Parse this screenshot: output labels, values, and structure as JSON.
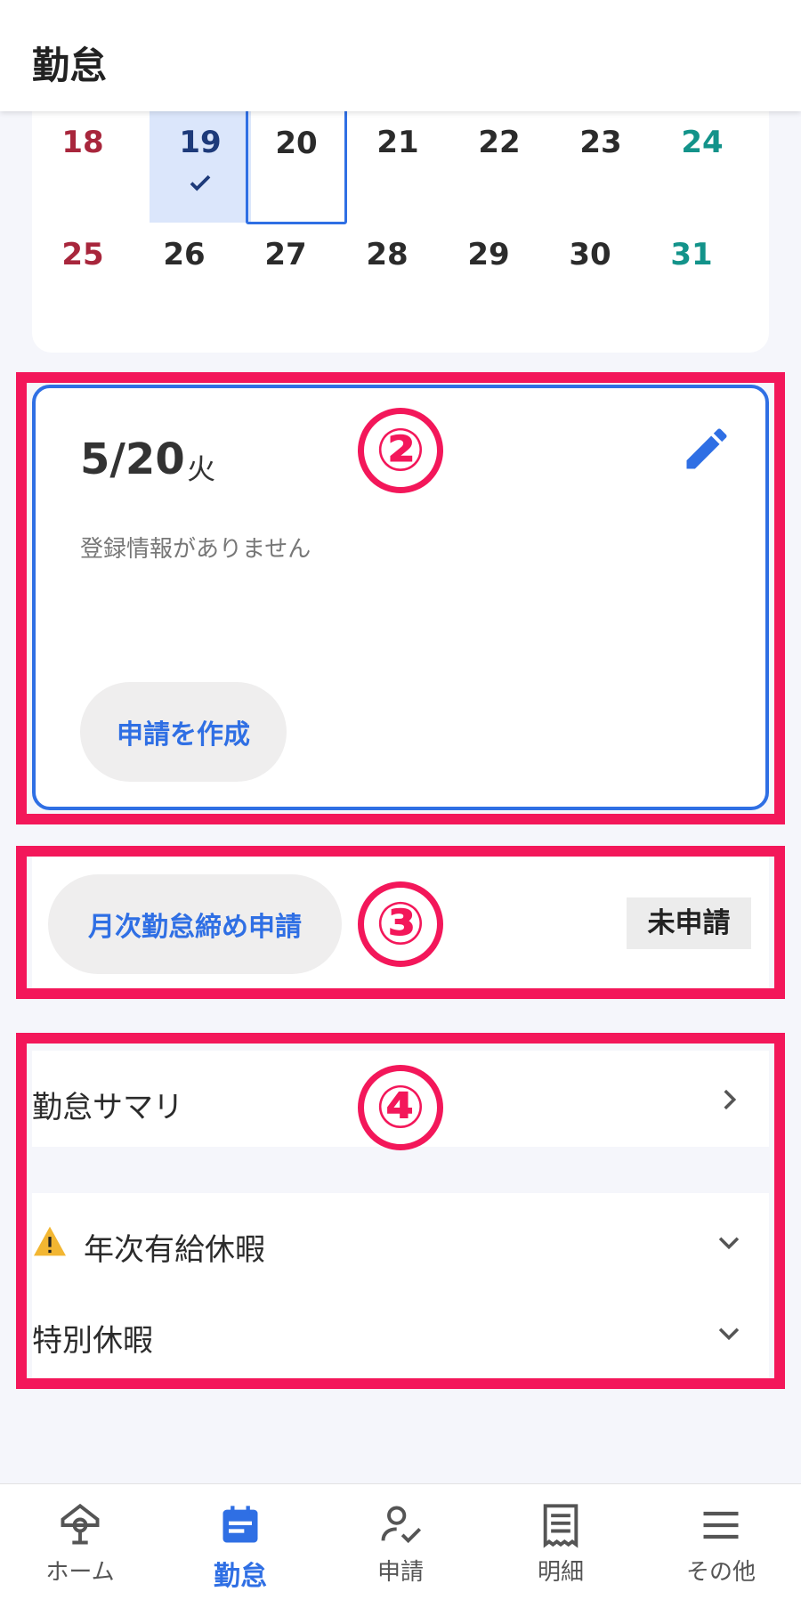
{
  "header": {
    "title": "勤怠"
  },
  "calendar": {
    "rows": [
      [
        "18",
        "19",
        "20",
        "21",
        "22",
        "23",
        "24"
      ],
      [
        "25",
        "26",
        "27",
        "28",
        "29",
        "30",
        "31"
      ]
    ]
  },
  "day_detail": {
    "date": "5/20",
    "weekday": "火",
    "empty_message": "登録情報がありません",
    "create_button": "申請を作成"
  },
  "monthly": {
    "button": "月次勤怠締め申請",
    "status": "未申請"
  },
  "list": {
    "summary": "勤怠サマリ",
    "annual_leave": "年次有給休暇",
    "special_leave": "特別休暇"
  },
  "annotations": {
    "two": "②",
    "three": "③",
    "four": "④"
  },
  "nav": {
    "items": [
      {
        "label": "ホーム",
        "icon": "home-icon"
      },
      {
        "label": "勤怠",
        "icon": "calendar-icon"
      },
      {
        "label": "申請",
        "icon": "request-icon"
      },
      {
        "label": "明細",
        "icon": "statement-icon"
      },
      {
        "label": "その他",
        "icon": "menu-icon"
      }
    ]
  },
  "colors": {
    "accent": "#2f6fe4",
    "highlight": "#f3175a",
    "sunday": "#a8263c",
    "saturday": "#13938a",
    "selected_bg": "#dbe6fb"
  }
}
